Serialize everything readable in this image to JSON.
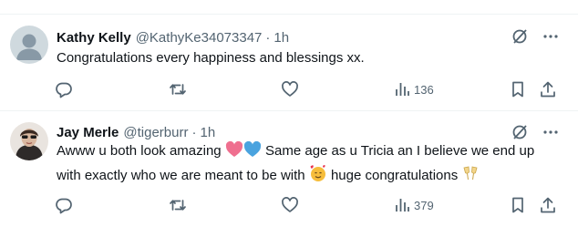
{
  "posts": [
    {
      "name": "Kathy Kelly",
      "handle": "@KathyKe34073347",
      "separator": "·",
      "time": "1h",
      "text": "Congratulations every happiness and blessings xx.",
      "views": "136",
      "avatar": "default-avatar"
    },
    {
      "name": "Jay Merle",
      "handle": "@tigerburr",
      "separator": "·",
      "time": "1h",
      "text_part1": "Awww u both look amazing ",
      "text_part2": " Same age as u Tricia an I believe we end up with exactly who we are meant to be with ",
      "text_part3": " huge congratulations ",
      "emoji_1": "pink-heart",
      "emoji_2": "blue-heart",
      "emoji_3": "smiling-face-with-hearts",
      "emoji_4": "clinking-glasses",
      "views": "379",
      "avatar": "user-photo"
    }
  ],
  "icons": {
    "grok": "grok-icon",
    "more": "more-icon",
    "reply": "reply-icon",
    "repost": "repost-icon",
    "like": "like-icon",
    "views": "views-icon",
    "bookmark": "bookmark-icon",
    "share": "share-icon"
  },
  "colors": {
    "text": "#0f1419",
    "secondary": "#536471",
    "divider": "#eff3f4"
  }
}
